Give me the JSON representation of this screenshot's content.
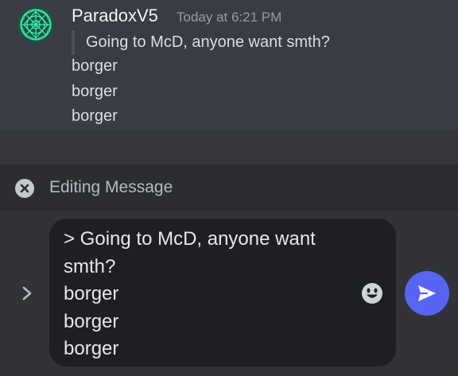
{
  "message": {
    "author": "ParadoxV5",
    "timestamp": "Today at 6:21 PM",
    "quote": "Going to McD, anyone want smth?",
    "lines": [
      "borger",
      "borger",
      "borger"
    ]
  },
  "edit_bar": {
    "label": "Editing Message",
    "close_icon": "close-icon"
  },
  "composer": {
    "lines": [
      "> Going to McD, anyone want",
      "smth?",
      "borger",
      "borger",
      "borger"
    ],
    "emoji_icon": "smiley-icon",
    "send_icon": "send-icon",
    "expand_icon": "chevron-right-icon"
  },
  "colors": {
    "accent": "#5865f2",
    "avatar": "#1f5f4f"
  }
}
